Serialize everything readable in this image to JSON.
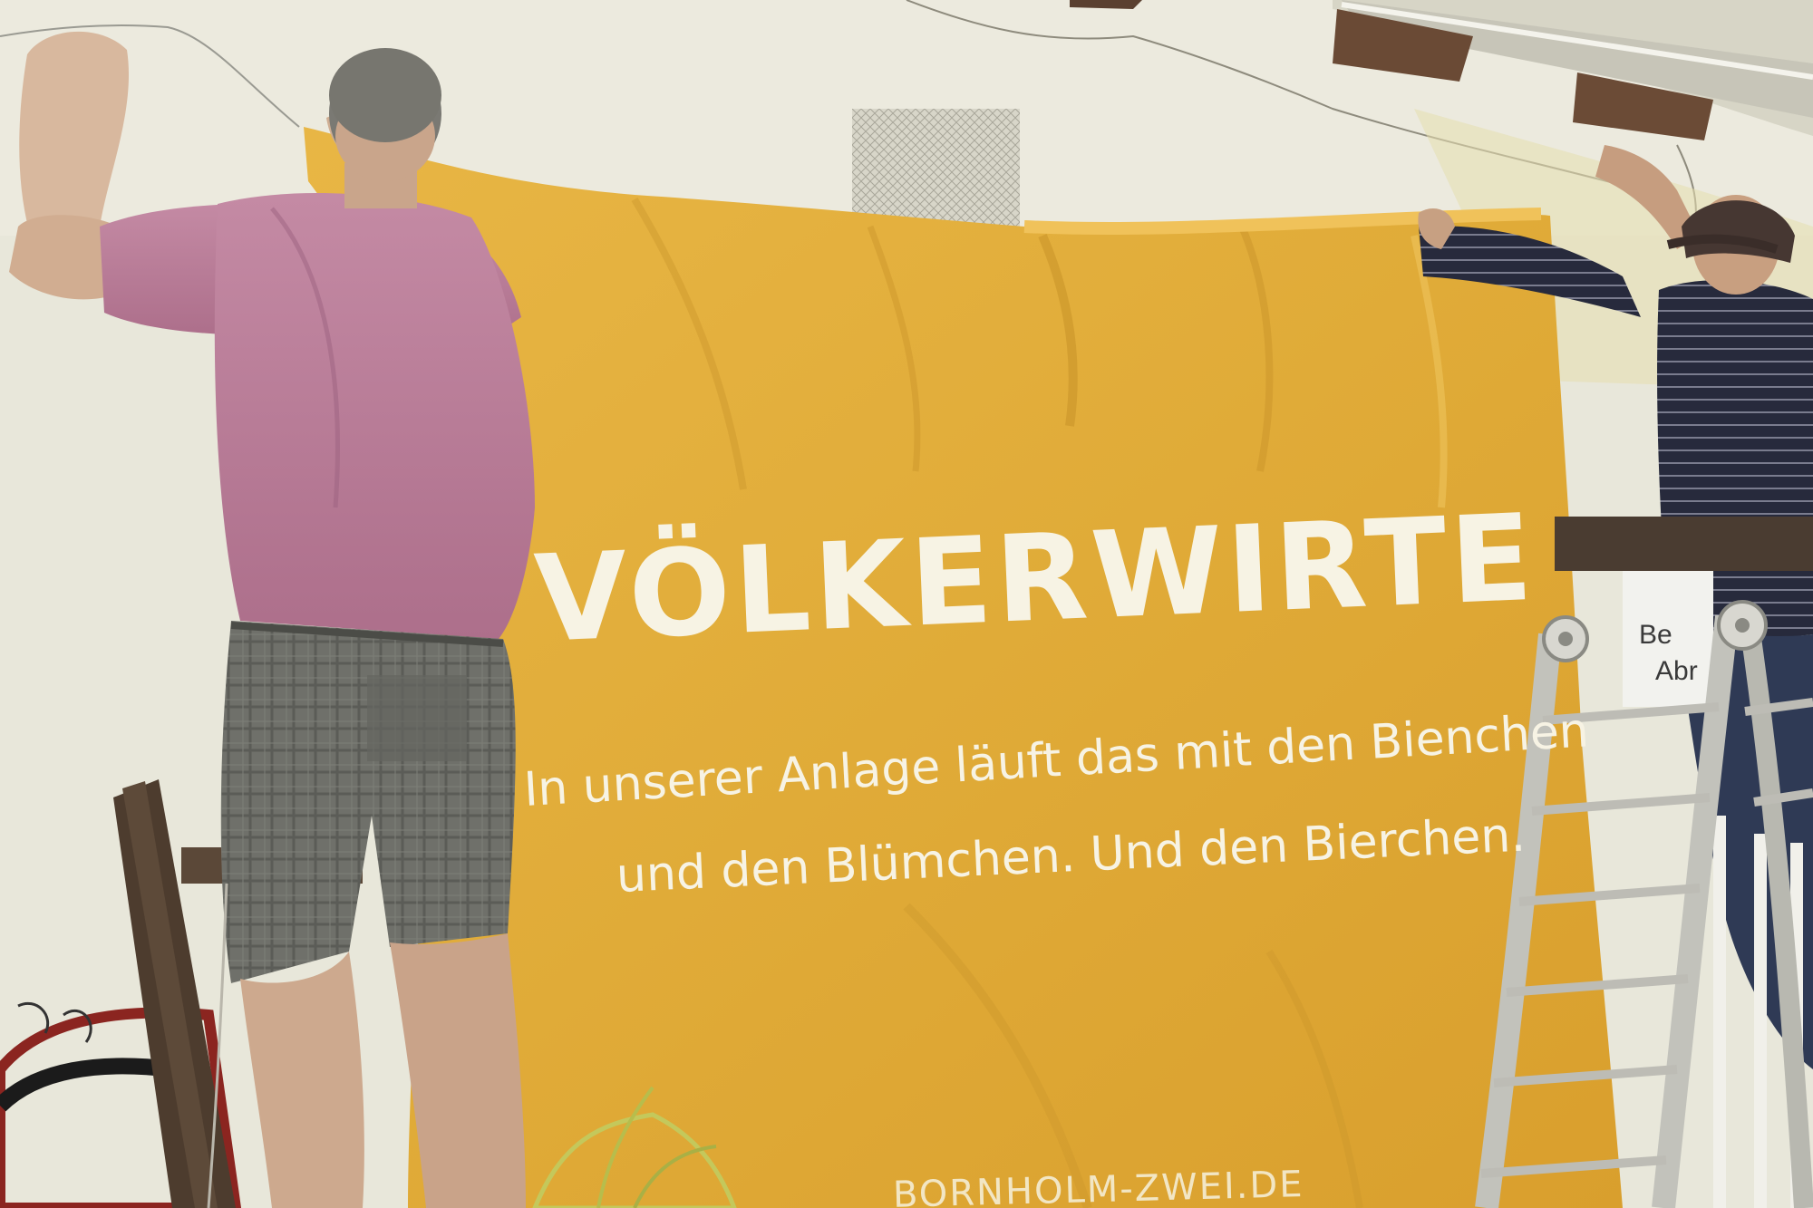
{
  "banner": {
    "headline": "VÖLKERWIRTE",
    "tagline_line1": "In unserer Anlage läuft das mit den Bienchen",
    "tagline_line2": "und den Blümchen. Und den Bierchen.",
    "website": "BORNHOLM-ZWEI.DE",
    "color": "#e1ad3a",
    "text_color": "#f7f3e4"
  },
  "background_sign": {
    "line1": "Be",
    "line2": "Abr"
  },
  "colors": {
    "wall": "#e9e8dc",
    "banner": "#e1ad3a",
    "left_shirt": "#b87a97",
    "right_shirt": "#2a2d3f",
    "ladder": "#c9c9c2"
  }
}
